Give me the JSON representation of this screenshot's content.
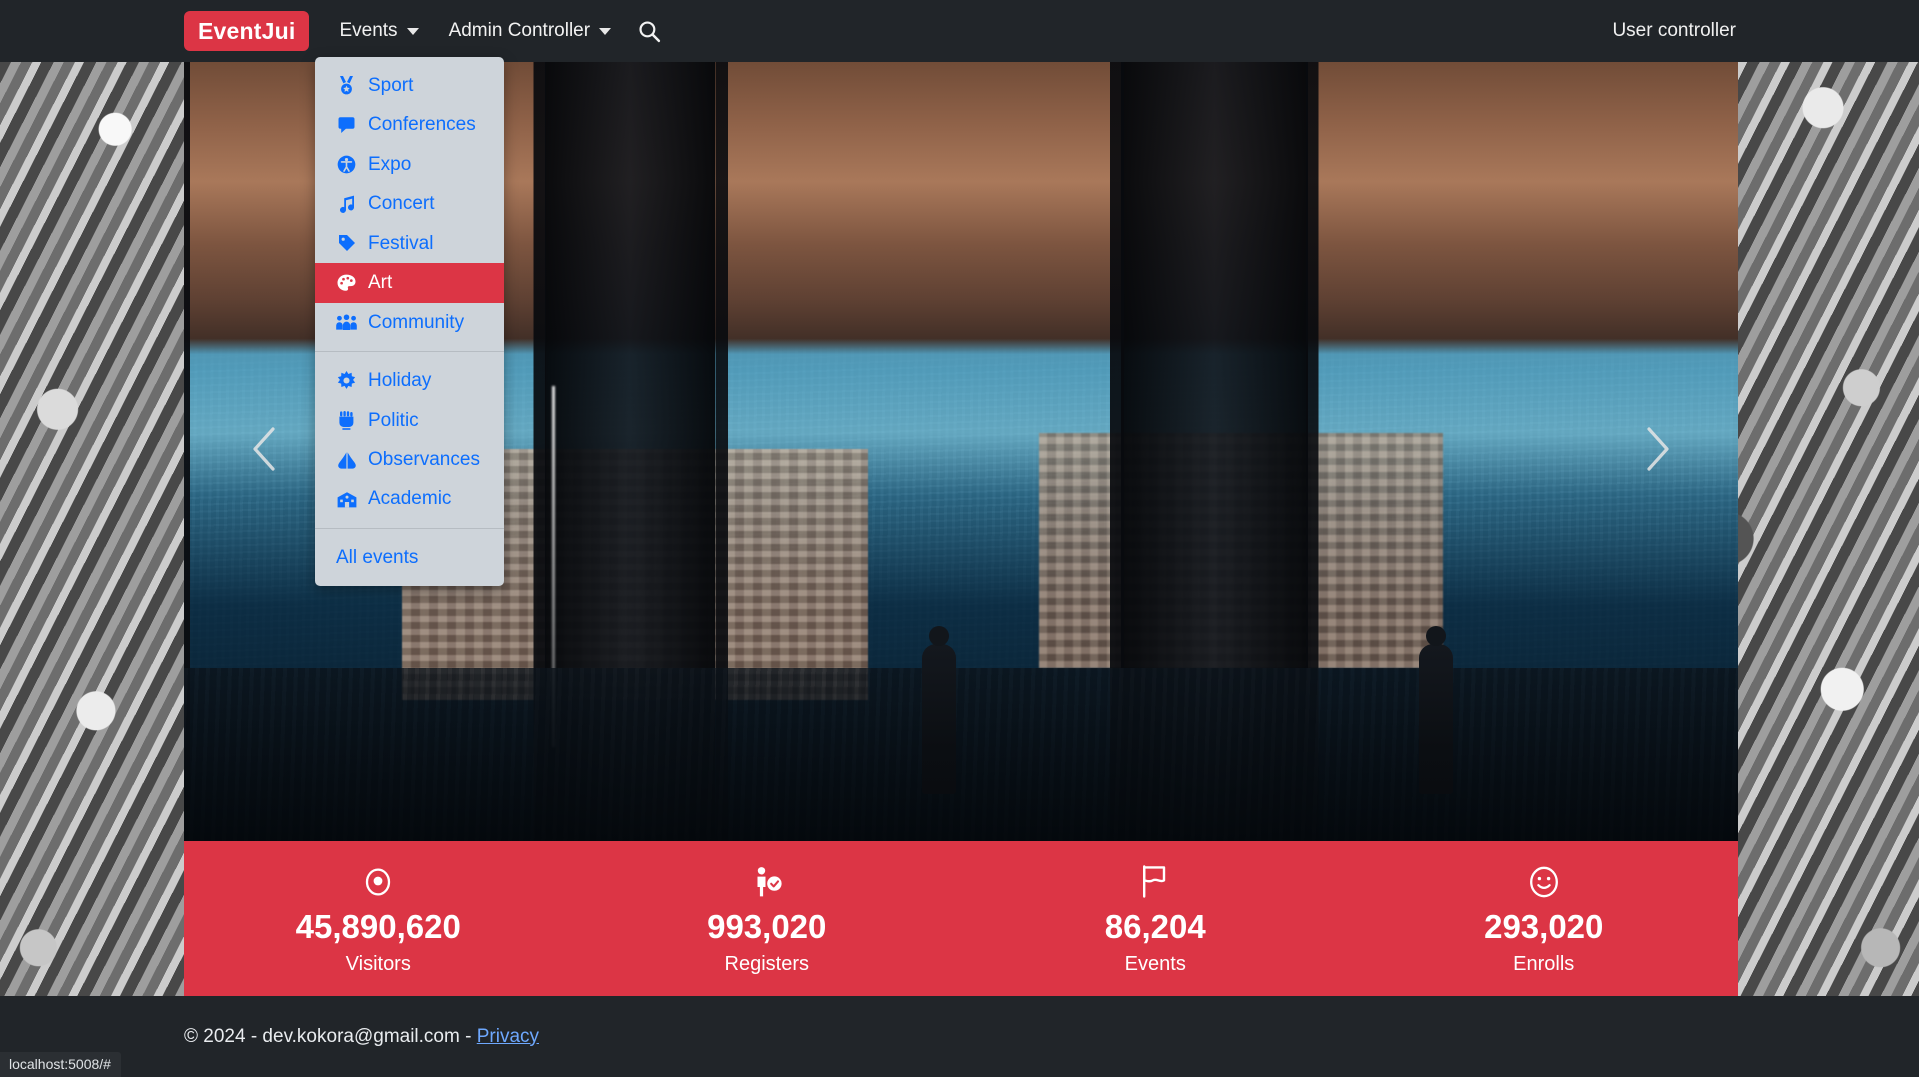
{
  "navbar": {
    "brand": "EventJui",
    "events_label": "Events",
    "admin_label": "Admin Controller",
    "search_icon": "search-icon",
    "user_controller": "User controller"
  },
  "dropdown": {
    "groups": [
      {
        "items": [
          {
            "label": "Sport",
            "icon": "medal-icon",
            "active": false
          },
          {
            "label": "Conferences",
            "icon": "comment-icon",
            "active": false
          },
          {
            "label": "Expo",
            "icon": "accessibility-icon",
            "active": false
          },
          {
            "label": "Concert",
            "icon": "music-note-icon",
            "active": false
          },
          {
            "label": "Festival",
            "icon": "tag-icon",
            "active": false
          },
          {
            "label": "Art",
            "icon": "palette-icon",
            "active": true
          },
          {
            "label": "Community",
            "icon": "people-group-icon",
            "active": false
          }
        ]
      },
      {
        "items": [
          {
            "label": "Holiday",
            "icon": "sun-icon",
            "active": false
          },
          {
            "label": "Politic",
            "icon": "raised-fist-icon",
            "active": false
          },
          {
            "label": "Observances",
            "icon": "praying-hands-icon",
            "active": false
          },
          {
            "label": "Academic",
            "icon": "school-icon",
            "active": false
          }
        ]
      },
      {
        "items": [
          {
            "label": "All events",
            "icon": "",
            "active": false
          }
        ]
      }
    ]
  },
  "carousel": {
    "prev_label": "Previous",
    "next_label": "Next"
  },
  "stats": [
    {
      "value": "45,890,620",
      "label": "Visitors",
      "icon": "eye-icon"
    },
    {
      "value": "993,020",
      "label": "Registers",
      "icon": "person-check-icon"
    },
    {
      "value": "86,204",
      "label": "Events",
      "icon": "flag-icon"
    },
    {
      "value": "293,020",
      "label": "Enrolls",
      "icon": "smiley-icon"
    }
  ],
  "footer": {
    "copyright": "© 2024 - dev.kokora@gmail.com - ",
    "privacy_label": "Privacy"
  },
  "statusbar": {
    "url": "localhost:5008/#"
  },
  "colors": {
    "brand_red": "#dc3545",
    "navbar_dark": "#212529",
    "dropdown_bg": "#ced4da",
    "link_blue": "#0d6efd"
  }
}
